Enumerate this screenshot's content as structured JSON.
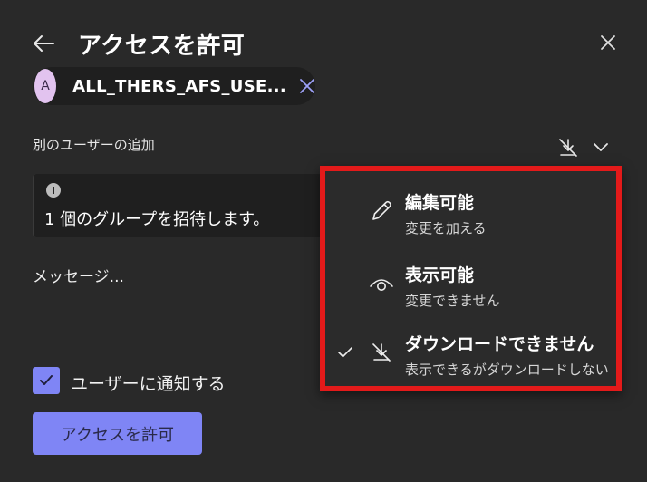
{
  "dialog": {
    "title": "アクセスを許可"
  },
  "recipient_chip": {
    "avatar_initial": "A",
    "label": "ALL_THERS_AFS_USE..."
  },
  "add_users": {
    "label": "別のユーザーの追加"
  },
  "info": {
    "icon": "info-icon",
    "text": "1 個のグループを招待します。"
  },
  "message": {
    "placeholder": "メッセージ..."
  },
  "notify": {
    "label": "ユーザーに通知する",
    "checked": true
  },
  "grant_button": {
    "label": "アクセスを許可"
  },
  "permission_menu": {
    "selected": "cannot-download",
    "items": [
      {
        "icon": "pencil-icon",
        "label": "編集可能",
        "description": "変更を加える",
        "checked": false
      },
      {
        "icon": "eye-icon",
        "label": "表示可能",
        "description": "変更できません",
        "checked": false
      },
      {
        "icon": "no-download-icon",
        "label": "ダウンロードできません",
        "description": "表示できるがダウンロードしない",
        "checked": true
      }
    ]
  },
  "colors": {
    "background": "#292929",
    "accent": "#7f85f5",
    "highlight_border": "#e31a1a"
  }
}
